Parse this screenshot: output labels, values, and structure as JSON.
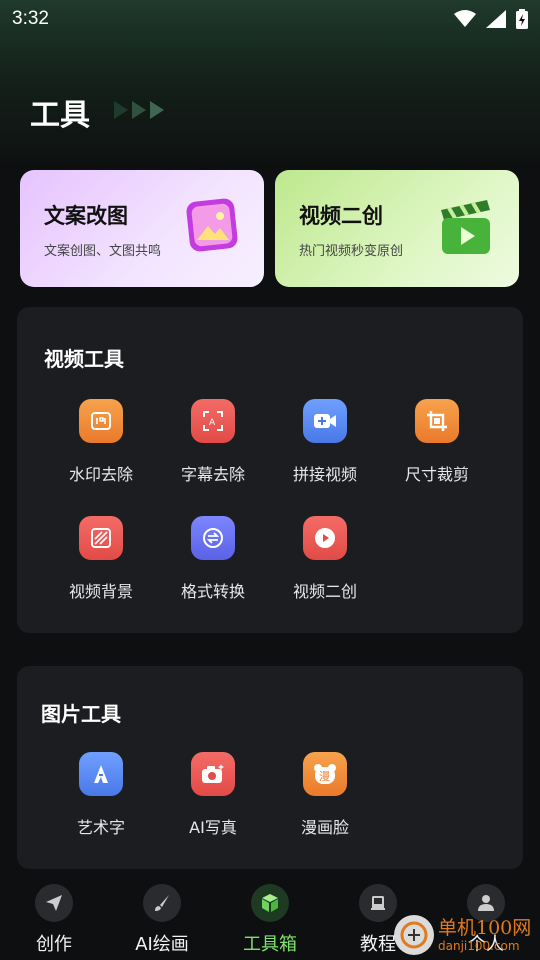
{
  "status_bar": {
    "time": "3:32"
  },
  "page": {
    "title": "工具"
  },
  "feature_cards": [
    {
      "title": "文案改图",
      "subtitle": "文案创图、文图共鸣",
      "icon": "image-icon"
    },
    {
      "title": "视频二创",
      "subtitle": "热门视频秒变原创",
      "icon": "clapperboard-icon"
    }
  ],
  "video_tools": {
    "title": "视频工具",
    "items": [
      {
        "label": "水印去除",
        "icon": "watermark-icon",
        "color": "#f08a3a"
      },
      {
        "label": "字幕去除",
        "icon": "subtitle-icon",
        "color": "#ee5a55"
      },
      {
        "label": "拼接视频",
        "icon": "video-add-icon",
        "color": "#5b8cf2"
      },
      {
        "label": "尺寸裁剪",
        "icon": "crop-icon",
        "color": "#f08a3a"
      },
      {
        "label": "视频背景",
        "icon": "background-icon",
        "color": "#ee5a55"
      },
      {
        "label": "格式转换",
        "icon": "convert-icon",
        "color": "#6a73ee"
      },
      {
        "label": "视频二创",
        "icon": "play-icon",
        "color": "#ee5a55"
      }
    ]
  },
  "image_tools": {
    "title": "图片工具",
    "items": [
      {
        "label": "艺术字",
        "icon": "art-text-icon",
        "color": "#5b8cf2"
      },
      {
        "label": "AI写真",
        "icon": "camera-icon",
        "color": "#ee5a55"
      },
      {
        "label": "漫画脸",
        "icon": "comic-face-icon",
        "color": "#f08a3a"
      }
    ]
  },
  "bottom_nav": [
    {
      "label": "创作",
      "icon": "paper-plane-icon",
      "active": false
    },
    {
      "label": "AI绘画",
      "icon": "brush-icon",
      "active": false
    },
    {
      "label": "工具箱",
      "icon": "cube-icon",
      "active": true
    },
    {
      "label": "教程",
      "icon": "book-icon",
      "active": false
    },
    {
      "label": "个人",
      "icon": "user-icon",
      "active": false
    }
  ],
  "watermark": {
    "name": "单机100网",
    "url": "danji100.com"
  },
  "colors": {
    "accent_green": "#7ee36b",
    "panel_bg": "#1c1d21",
    "page_bg": "#0e0f10"
  }
}
